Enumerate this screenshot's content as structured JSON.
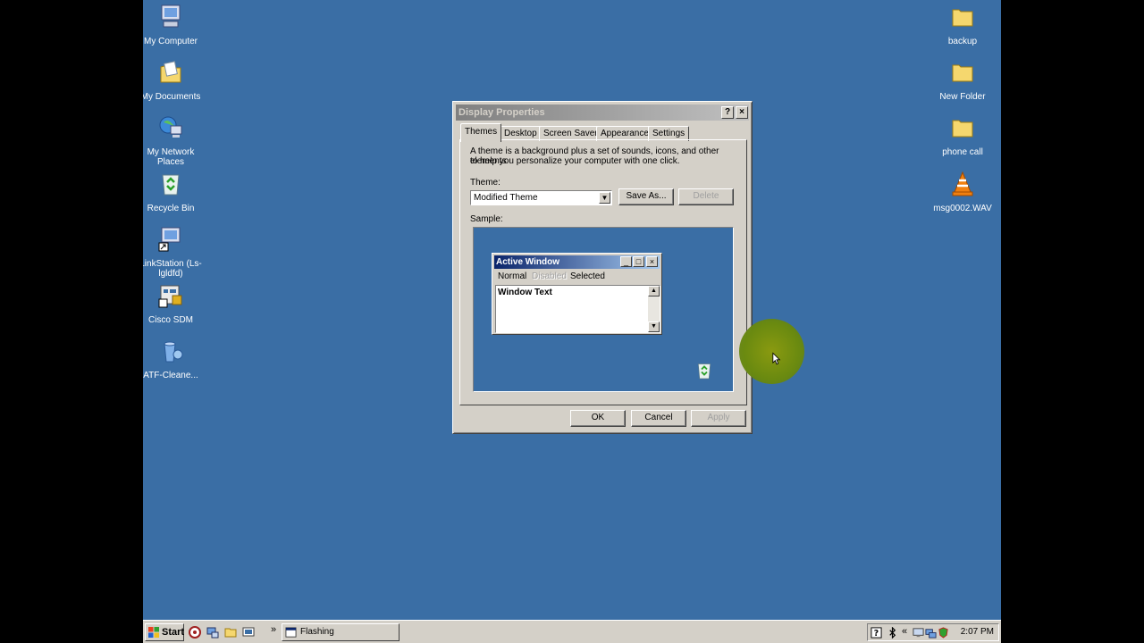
{
  "desktop": {
    "left_icons": [
      {
        "label": "My Computer",
        "icon": "my-computer-icon"
      },
      {
        "label": "My Documents",
        "icon": "my-documents-icon"
      },
      {
        "label": "My Network Places",
        "icon": "network-places-icon"
      },
      {
        "label": "Recycle Bin",
        "icon": "recycle-bin-icon"
      },
      {
        "label": "LinkStation (Ls-lgldfd)",
        "icon": "linkstation-icon"
      },
      {
        "label": "Cisco SDM",
        "icon": "cisco-sdm-icon"
      },
      {
        "label": "ATF-Cleane...",
        "icon": "atf-cleaner-icon"
      }
    ],
    "right_icons": [
      {
        "label": "backup",
        "icon": "folder-icon"
      },
      {
        "label": "New Folder",
        "icon": "folder-icon"
      },
      {
        "label": "phone call",
        "icon": "folder-icon"
      },
      {
        "label": "msg0002.WAV",
        "icon": "vlc-cone-icon"
      }
    ],
    "background_color": "#3a6ea5"
  },
  "dialog": {
    "title": "Display Properties",
    "help_button": "?",
    "close_button": "×",
    "tabs": [
      {
        "label": "Themes",
        "active": true
      },
      {
        "label": "Desktop",
        "active": false
      },
      {
        "label": "Screen Saver",
        "active": false
      },
      {
        "label": "Appearance",
        "active": false
      },
      {
        "label": "Settings",
        "active": false
      }
    ],
    "description_line1": "A theme is a background plus a set of sounds, icons, and other elements",
    "description_line2": "to help you personalize your computer with one click.",
    "theme_label": "Theme:",
    "theme_value": "Modified Theme",
    "save_as_label": "Save As...",
    "delete_label": "Delete",
    "sample_label": "Sample:",
    "sample": {
      "window_title": "Active Window",
      "menu_normal": "Normal",
      "menu_disabled": "Disabled",
      "menu_selected": "Selected",
      "window_text": "Window Text"
    },
    "ok_label": "OK",
    "cancel_label": "Cancel",
    "apply_label": "Apply"
  },
  "taskbar": {
    "start_label": "Start",
    "task_label": "Flashing",
    "chevron": "»",
    "tray_chevron": "«",
    "clock": "2:07 PM"
  },
  "colors": {
    "active_title_start": "#0a246a",
    "active_title_end": "#a6caf0",
    "cursor_highlight": "#b5b800"
  }
}
